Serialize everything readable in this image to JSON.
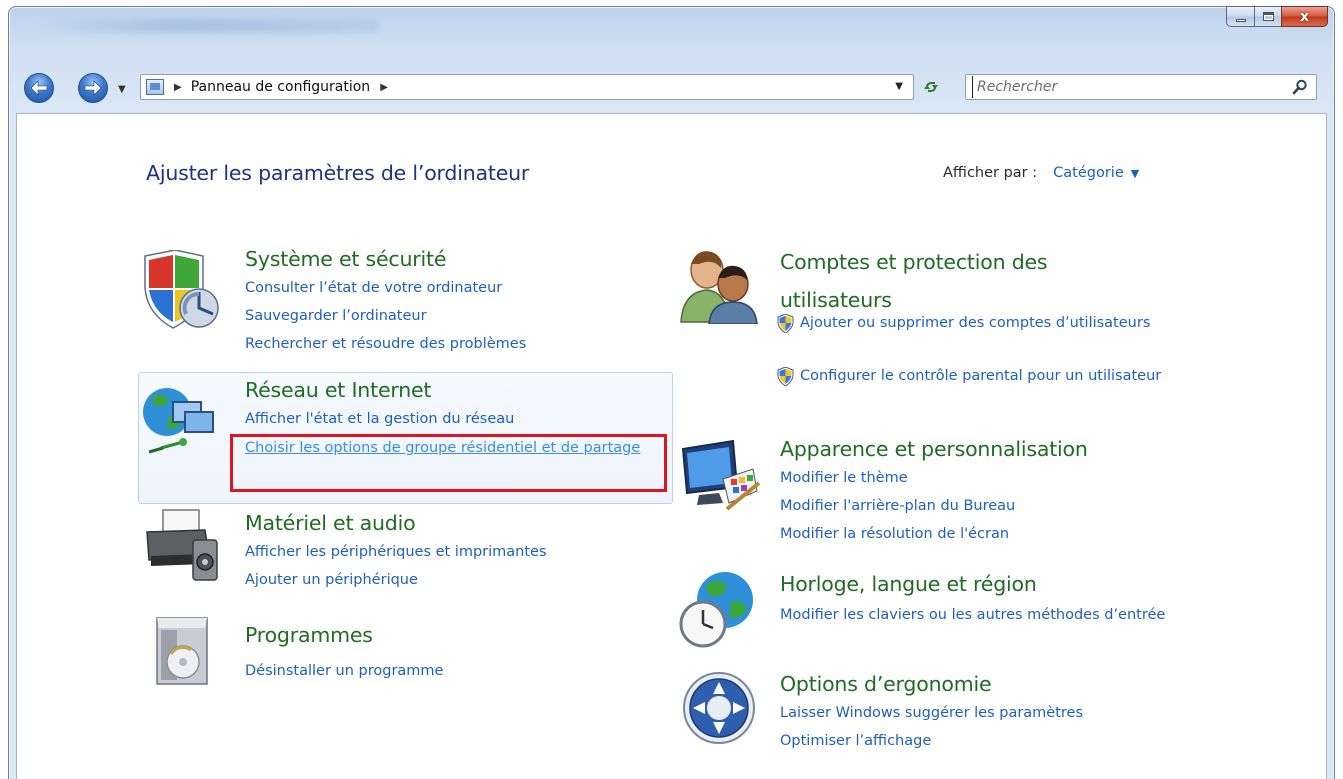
{
  "window": {
    "caption": {
      "minimize": "",
      "maximize": "",
      "close": "x"
    }
  },
  "nav": {
    "breadcrumb": [
      "Panneau de configuration"
    ],
    "search_placeholder": "Rechercher"
  },
  "header": {
    "title": "Ajuster les paramètres de l’ordinateur",
    "view_by_label": "Afficher par :",
    "view_by_value": "Catégorie"
  },
  "categories": {
    "system": {
      "title": "Système et sécurité",
      "links": [
        "Consulter l’état de votre ordinateur",
        "Sauvegarder l’ordinateur",
        "Rechercher et résoudre des problèmes"
      ]
    },
    "network": {
      "title": "Réseau et Internet",
      "links": [
        "Afficher l'état et la gestion du réseau",
        "Choisir les options de groupe résidentiel et de partage"
      ]
    },
    "hardware": {
      "title": "Matériel et audio",
      "links": [
        "Afficher les périphériques et imprimantes",
        "Ajouter un périphérique"
      ]
    },
    "programs": {
      "title": "Programmes",
      "links": [
        "Désinstaller un programme"
      ]
    },
    "accounts": {
      "title": "Comptes et protection des utilisateurs",
      "links": [
        "Ajouter ou supprimer des comptes d’utilisateurs",
        "Configurer le contrôle parental pour un utilisateur"
      ]
    },
    "appearance": {
      "title": "Apparence et personnalisation",
      "links": [
        "Modifier le thème",
        "Modifier l'arrière-plan du Bureau",
        "Modifier la résolution de l'écran"
      ]
    },
    "clock": {
      "title": "Horloge, langue et région",
      "links": [
        "Modifier les claviers ou les autres méthodes d’entrée"
      ]
    },
    "ease": {
      "title": "Options d’ergonomie",
      "links": [
        "Laisser Windows suggérer les paramètres",
        "Optimiser l’affichage"
      ]
    }
  },
  "icons": {
    "back": "back-arrow-icon",
    "forward": "forward-arrow-icon",
    "control_panel": "control-panel-icon",
    "refresh": "refresh-icon",
    "search": "search-icon",
    "uac_shield": "uac-shield-icon"
  },
  "colors": {
    "category_title": "#1f6c22",
    "link": "#1e5fc1",
    "page_title": "#1e3287",
    "highlight_border": "#e0141e"
  }
}
